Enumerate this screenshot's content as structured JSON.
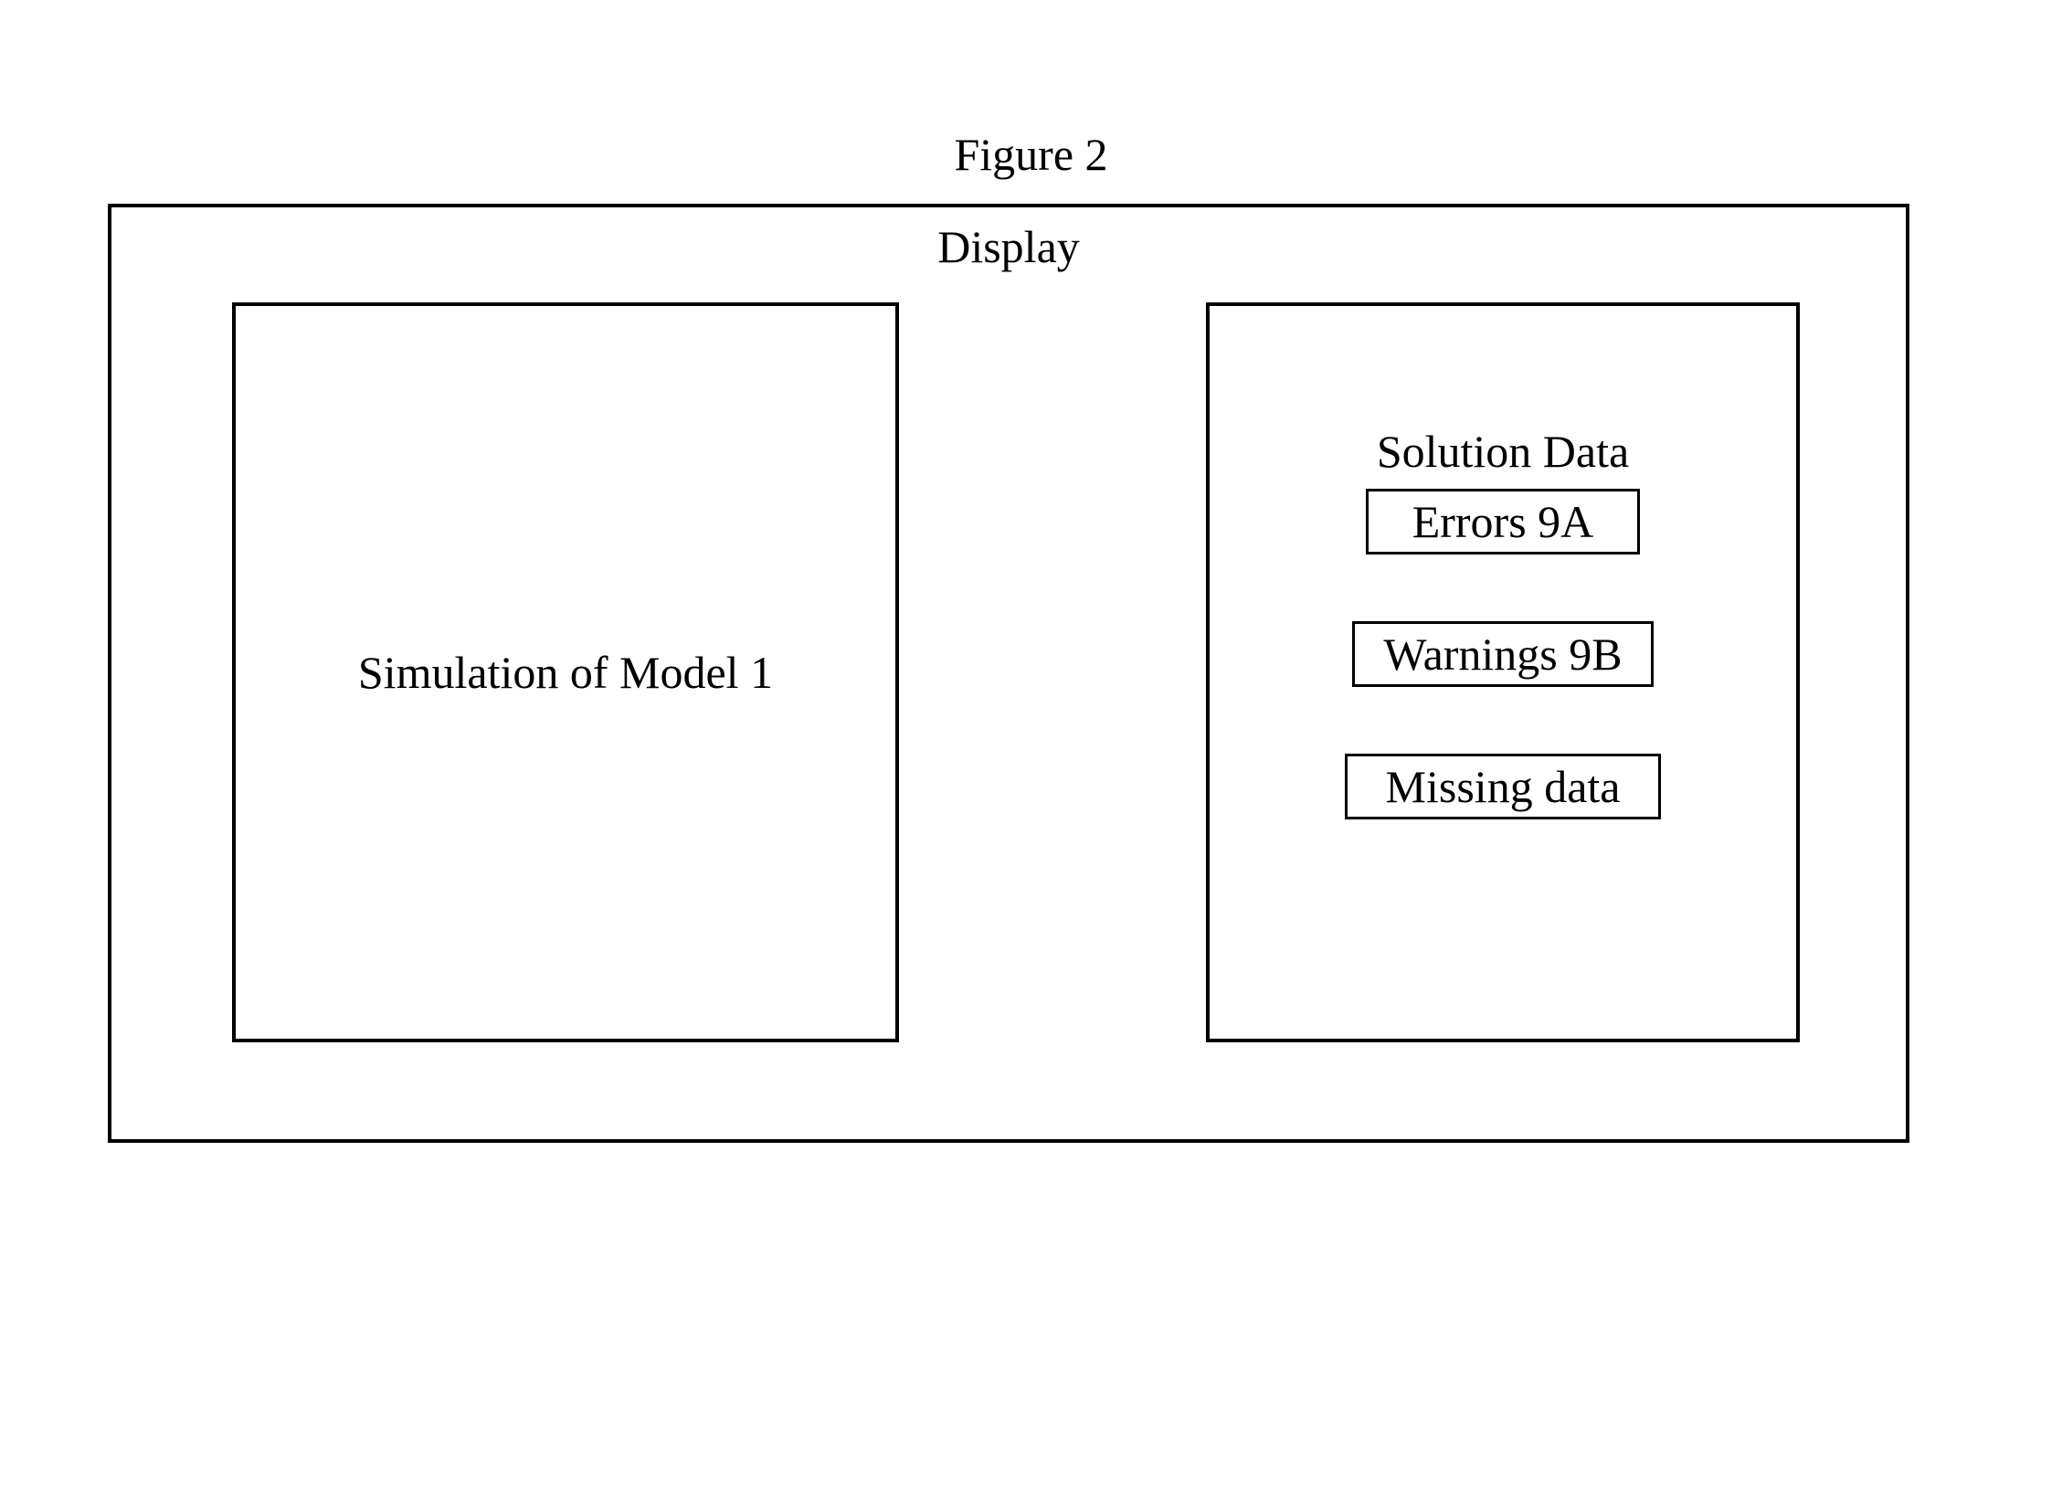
{
  "figure": {
    "title": "Figure 2"
  },
  "display": {
    "label": "Display",
    "leftPanel": {
      "label": "Simulation of Model 1"
    },
    "rightPanel": {
      "title": "Solution Data",
      "items": [
        "Errors 9A",
        "Warnings 9B",
        "Missing data"
      ]
    }
  }
}
